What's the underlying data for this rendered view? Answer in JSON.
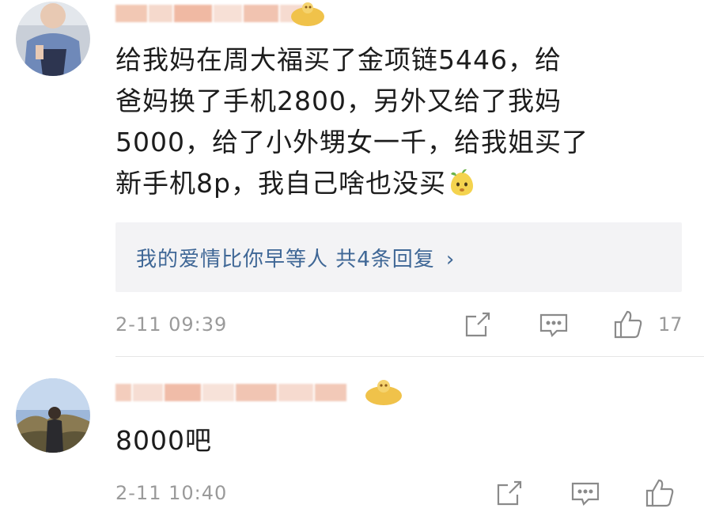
{
  "comments": [
    {
      "lines": [
        "给我妈在周大福买了金项链5446，给",
        "爸妈换了手机2800，另外又给了我妈",
        "5000，给了小外甥女一千，给我姐买了",
        "新手机8p，我自己啥也没买"
      ],
      "emoji": "pear-face-emoji",
      "reply_summary": "我的爱情比你早等人  共4条回复",
      "reply_chevron": "›",
      "timestamp": "2-11 09:39",
      "like_count": "17"
    },
    {
      "lines": [
        "8000吧"
      ],
      "timestamp": "2-11 10:40",
      "like_count": ""
    }
  ],
  "icons": {
    "share": "share-icon",
    "comment": "comment-icon",
    "like": "thumbs-up-icon"
  },
  "colors": {
    "text": "#1c1c1c",
    "link": "#3f6796",
    "meta": "#9a9a9a",
    "reply_bg": "#f3f3f5",
    "badge": "#f0c24a"
  }
}
